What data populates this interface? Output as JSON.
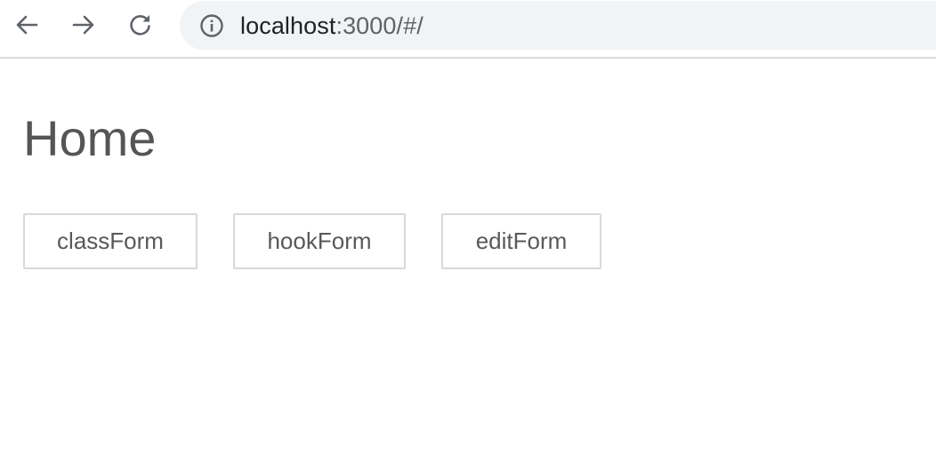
{
  "browser": {
    "url_host": "localhost",
    "url_rest": ":3000/#/",
    "icons": {
      "back": "arrow-left-icon",
      "forward": "arrow-right-icon",
      "reload": "reload-icon",
      "info": "info-icon"
    }
  },
  "page": {
    "title": "Home",
    "buttons": [
      {
        "label": "classForm"
      },
      {
        "label": "hookForm"
      },
      {
        "label": "editForm"
      }
    ]
  },
  "colors": {
    "toolbar_border": "#dadce0",
    "omnibox_bg": "#f1f3f4",
    "text": "#555555",
    "button_border": "#d9d9d9"
  }
}
